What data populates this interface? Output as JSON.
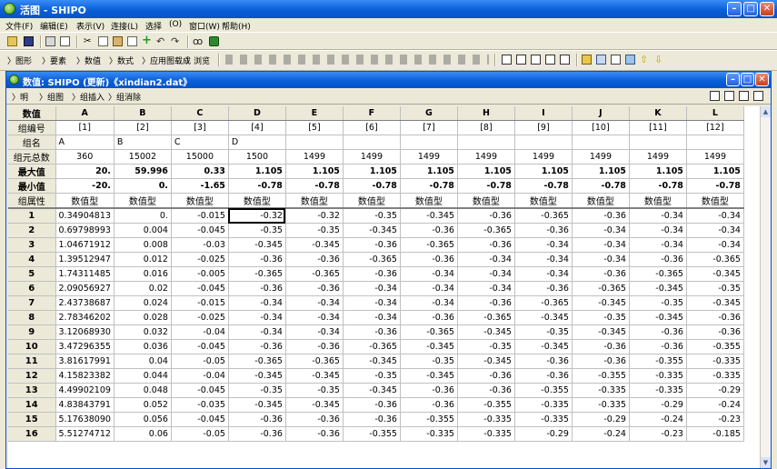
{
  "window": {
    "title": "活图 - SHIPO"
  },
  "menu": [
    "文件(F)",
    "编辑(E)",
    "表示(V)",
    "连接(L)",
    "选择",
    "(O)",
    "窗口(W)",
    "帮助(H)"
  ],
  "toolbar2": [
    "〉图形",
    "〉要素",
    "〉数值",
    "〉数式",
    "〉应用图载成",
    "〉浏览"
  ],
  "doc": {
    "title": "数值: SHIPO (更新)《xindian2.dat》"
  },
  "doc_toolbar": [
    "〉明",
    "〉组图",
    "〉组插入",
    "〉组消除"
  ],
  "grid": {
    "corner": "数值",
    "columns": [
      "A",
      "B",
      "C",
      "D",
      "E",
      "F",
      "G",
      "H",
      "I",
      "J",
      "K",
      "L"
    ],
    "meta_rows": [
      {
        "label": "组编号",
        "values": [
          "[1]",
          "[2]",
          "[3]",
          "[4]",
          "[5]",
          "[6]",
          "[7]",
          "[8]",
          "[9]",
          "[10]",
          "[11]",
          "[12]"
        ]
      },
      {
        "label": "组名",
        "values": [
          "A",
          "B",
          "C",
          "D",
          "",
          "",
          "",
          "",
          "",
          "",
          "",
          ""
        ]
      },
      {
        "label": "组元总数",
        "values": [
          "360",
          "15002",
          "15000",
          "1500",
          "1499",
          "1499",
          "1499",
          "1499",
          "1499",
          "1499",
          "1499",
          "1499"
        ]
      },
      {
        "label": "最大值",
        "values": [
          "20.",
          "59.996",
          "0.33",
          "1.105",
          "1.105",
          "1.105",
          "1.105",
          "1.105",
          "1.105",
          "1.105",
          "1.105",
          "1.105"
        ]
      },
      {
        "label": "最小值",
        "values": [
          "-20.",
          "0.",
          "-1.65",
          "-0.78",
          "-0.78",
          "-0.78",
          "-0.78",
          "-0.78",
          "-0.78",
          "-0.78",
          "-0.78",
          "-0.78"
        ]
      },
      {
        "label": "组属性",
        "values": [
          "数值型",
          "数值型",
          "数值型",
          "数值型",
          "数值型",
          "数值型",
          "数值型",
          "数值型",
          "数值型",
          "数值型",
          "数值型",
          "数值型"
        ]
      }
    ],
    "rows": [
      [
        "1",
        "0.34904813",
        "0.",
        "-0.015",
        "-0.32",
        "-0.32",
        "-0.35",
        "-0.345",
        "-0.36",
        "-0.365",
        "-0.36",
        "-0.34",
        "-0.34"
      ],
      [
        "2",
        "0.69798993",
        "0.004",
        "-0.045",
        "-0.35",
        "-0.35",
        "-0.345",
        "-0.36",
        "-0.365",
        "-0.36",
        "-0.34",
        "-0.34",
        "-0.34"
      ],
      [
        "3",
        "1.04671912",
        "0.008",
        "-0.03",
        "-0.345",
        "-0.345",
        "-0.36",
        "-0.365",
        "-0.36",
        "-0.34",
        "-0.34",
        "-0.34",
        "-0.34"
      ],
      [
        "4",
        "1.39512947",
        "0.012",
        "-0.025",
        "-0.36",
        "-0.36",
        "-0.365",
        "-0.36",
        "-0.34",
        "-0.34",
        "-0.34",
        "-0.36",
        "-0.365"
      ],
      [
        "5",
        "1.74311485",
        "0.016",
        "-0.005",
        "-0.365",
        "-0.365",
        "-0.36",
        "-0.34",
        "-0.34",
        "-0.34",
        "-0.36",
        "-0.365",
        "-0.345"
      ],
      [
        "6",
        "2.09056927",
        "0.02",
        "-0.045",
        "-0.36",
        "-0.36",
        "-0.34",
        "-0.34",
        "-0.34",
        "-0.36",
        "-0.365",
        "-0.345",
        "-0.35"
      ],
      [
        "7",
        "2.43738687",
        "0.024",
        "-0.015",
        "-0.34",
        "-0.34",
        "-0.34",
        "-0.34",
        "-0.36",
        "-0.365",
        "-0.345",
        "-0.35",
        "-0.345"
      ],
      [
        "8",
        "2.78346202",
        "0.028",
        "-0.025",
        "-0.34",
        "-0.34",
        "-0.34",
        "-0.36",
        "-0.365",
        "-0.345",
        "-0.35",
        "-0.345",
        "-0.36"
      ],
      [
        "9",
        "3.12068930",
        "0.032",
        "-0.04",
        "-0.34",
        "-0.34",
        "-0.36",
        "-0.365",
        "-0.345",
        "-0.35",
        "-0.345",
        "-0.36",
        "-0.36"
      ],
      [
        "10",
        "3.47296355",
        "0.036",
        "-0.045",
        "-0.36",
        "-0.36",
        "-0.365",
        "-0.345",
        "-0.35",
        "-0.345",
        "-0.36",
        "-0.36",
        "-0.355"
      ],
      [
        "11",
        "3.81617991",
        "0.04",
        "-0.05",
        "-0.365",
        "-0.365",
        "-0.345",
        "-0.35",
        "-0.345",
        "-0.36",
        "-0.36",
        "-0.355",
        "-0.335"
      ],
      [
        "12",
        "4.15823382",
        "0.044",
        "-0.04",
        "-0.345",
        "-0.345",
        "-0.35",
        "-0.345",
        "-0.36",
        "-0.36",
        "-0.355",
        "-0.335",
        "-0.335"
      ],
      [
        "13",
        "4.49902109",
        "0.048",
        "-0.045",
        "-0.35",
        "-0.35",
        "-0.345",
        "-0.36",
        "-0.36",
        "-0.355",
        "-0.335",
        "-0.335",
        "-0.29"
      ],
      [
        "14",
        "4.83843791",
        "0.052",
        "-0.035",
        "-0.345",
        "-0.345",
        "-0.36",
        "-0.36",
        "-0.355",
        "-0.335",
        "-0.335",
        "-0.29",
        "-0.24"
      ],
      [
        "15",
        "5.17638090",
        "0.056",
        "-0.045",
        "-0.36",
        "-0.36",
        "-0.36",
        "-0.355",
        "-0.335",
        "-0.335",
        "-0.29",
        "-0.24",
        "-0.23"
      ],
      [
        "16",
        "5.51274712",
        "0.06",
        "-0.05",
        "-0.36",
        "-0.36",
        "-0.355",
        "-0.335",
        "-0.335",
        "-0.29",
        "-0.24",
        "-0.23",
        "-0.185"
      ]
    ]
  },
  "colors": {
    "titlebar": "#0a5fd8",
    "chrome": "#ece9d8",
    "grid_line": "#c0c0c0"
  }
}
